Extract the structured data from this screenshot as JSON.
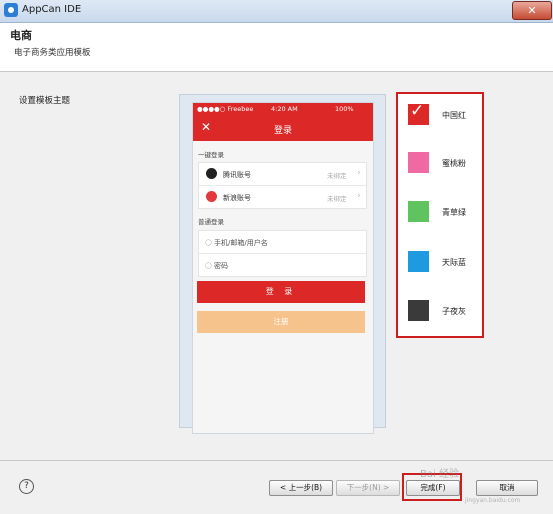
{
  "window": {
    "title": "AppCan IDE",
    "close_label": "✕"
  },
  "header": {
    "title": "电商",
    "subtitle": "电子商务类应用模板"
  },
  "theme_label": "设置模板主题",
  "phone": {
    "status_left": "●●●●○ Freebee ",
    "status_time": "4:20 AM",
    "status_right": "100%",
    "nav_title": "登录",
    "nav_close": "✕",
    "quick_login_label": "一键登录",
    "accounts": [
      {
        "label": "腾讯账号",
        "status": "未绑定",
        "icon": "qq-icon",
        "color": "#222222"
      },
      {
        "label": "新浪账号",
        "status": "未绑定",
        "icon": "weibo-icon",
        "color": "#e4393c"
      }
    ],
    "normal_login_label": "普通登录",
    "fields": [
      {
        "label": "手机/邮箱/用户名",
        "icon": "user-icon"
      },
      {
        "label": "密码",
        "icon": "lock-icon"
      }
    ],
    "login_button": "登 录",
    "register_button": "注册"
  },
  "themes": [
    {
      "name": "中国红",
      "color": "#dd2828",
      "selected": true
    },
    {
      "name": "蜜桃粉",
      "color": "#ee6aa0",
      "selected": false
    },
    {
      "name": "青草绿",
      "color": "#5fc35f",
      "selected": false
    },
    {
      "name": "天际蓝",
      "color": "#1e9be0",
      "selected": false
    },
    {
      "name": "子夜灰",
      "color": "#3a3a3a",
      "selected": false
    }
  ],
  "footer": {
    "help": "?",
    "back": "< 上一步(B)",
    "next": "下一步(N) >",
    "finish": "完成(F)",
    "cancel": "取消"
  },
  "watermark": {
    "text": "Bai 经验",
    "url": "jingyan.baidu.com"
  }
}
